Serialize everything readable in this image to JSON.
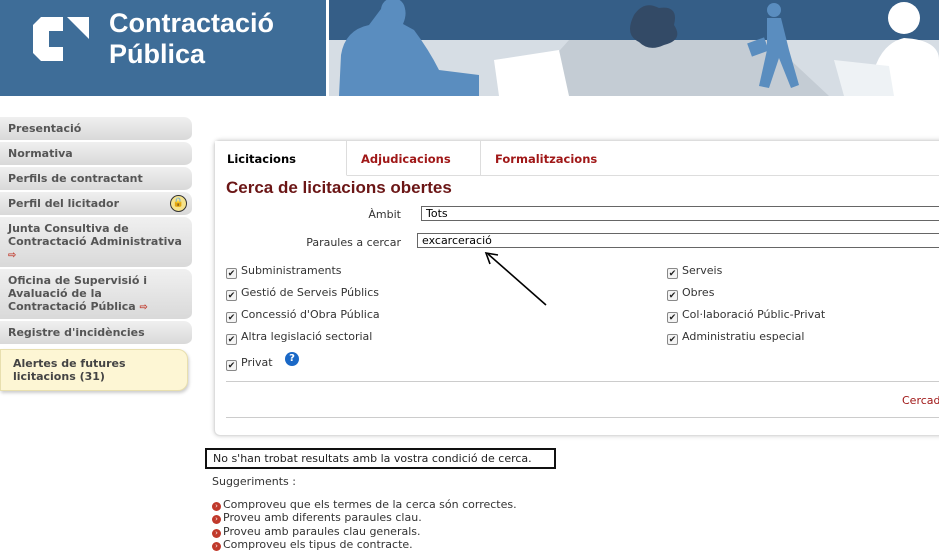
{
  "header": {
    "title_line1": "Contractació",
    "title_line2": "Pública",
    "brand_color": "#3e6d98"
  },
  "sidebar": {
    "items": [
      {
        "label": "Presentació"
      },
      {
        "label": "Normativa"
      },
      {
        "label": "Perfils de contractant"
      },
      {
        "label": "Perfil del licitador",
        "icon": "lock-icon"
      },
      {
        "label": "Junta Consultiva de Contractació Administrativa",
        "icon": "external-link-icon"
      },
      {
        "label": "Oficina de Supervisió i Avaluació de la Contractació Pública",
        "icon": "external-link-icon"
      },
      {
        "label": "Registre d'incidències"
      }
    ],
    "alerts_label": "Alertes de futures licitacions (31)"
  },
  "tabs": [
    {
      "label": "Licitacions",
      "active": true
    },
    {
      "label": "Adjudicacions",
      "active": false
    },
    {
      "label": "Formalitzacions",
      "active": false
    }
  ],
  "form": {
    "title": "Cerca de licitacions obertes",
    "ambit_label": "Àmbit",
    "ambit_value": "Tots",
    "keywords_label": "Paraules a cercar",
    "keywords_value": "excarceració",
    "checkboxes_left": [
      {
        "label": "Subministraments",
        "checked": true
      },
      {
        "label": "Gestió de Serveis Públics",
        "checked": true
      },
      {
        "label": "Concessió d'Obra Pública",
        "checked": true
      },
      {
        "label": "Altra legislació sectorial",
        "checked": true
      },
      {
        "label": "Privat",
        "checked": true
      }
    ],
    "checkboxes_right": [
      {
        "label": "Serveis",
        "checked": true
      },
      {
        "label": "Obres",
        "checked": true
      },
      {
        "label": "Col·laboració Públic-Privat",
        "checked": true
      },
      {
        "label": "Administratiu especial",
        "checked": true
      }
    ],
    "help_glyph": "?",
    "search_link": "Cercad"
  },
  "results": {
    "message": "No s'han trobat resultats amb la vostra condició de cerca.",
    "suggestions_title": "Suggeriments :",
    "suggestions": [
      "Comproveu que els termes de la cerca són correctes.",
      "Proveu amb diferents paraules clau.",
      "Proveu amb paraules clau generals.",
      "Comproveu els tipus de contracte."
    ]
  }
}
